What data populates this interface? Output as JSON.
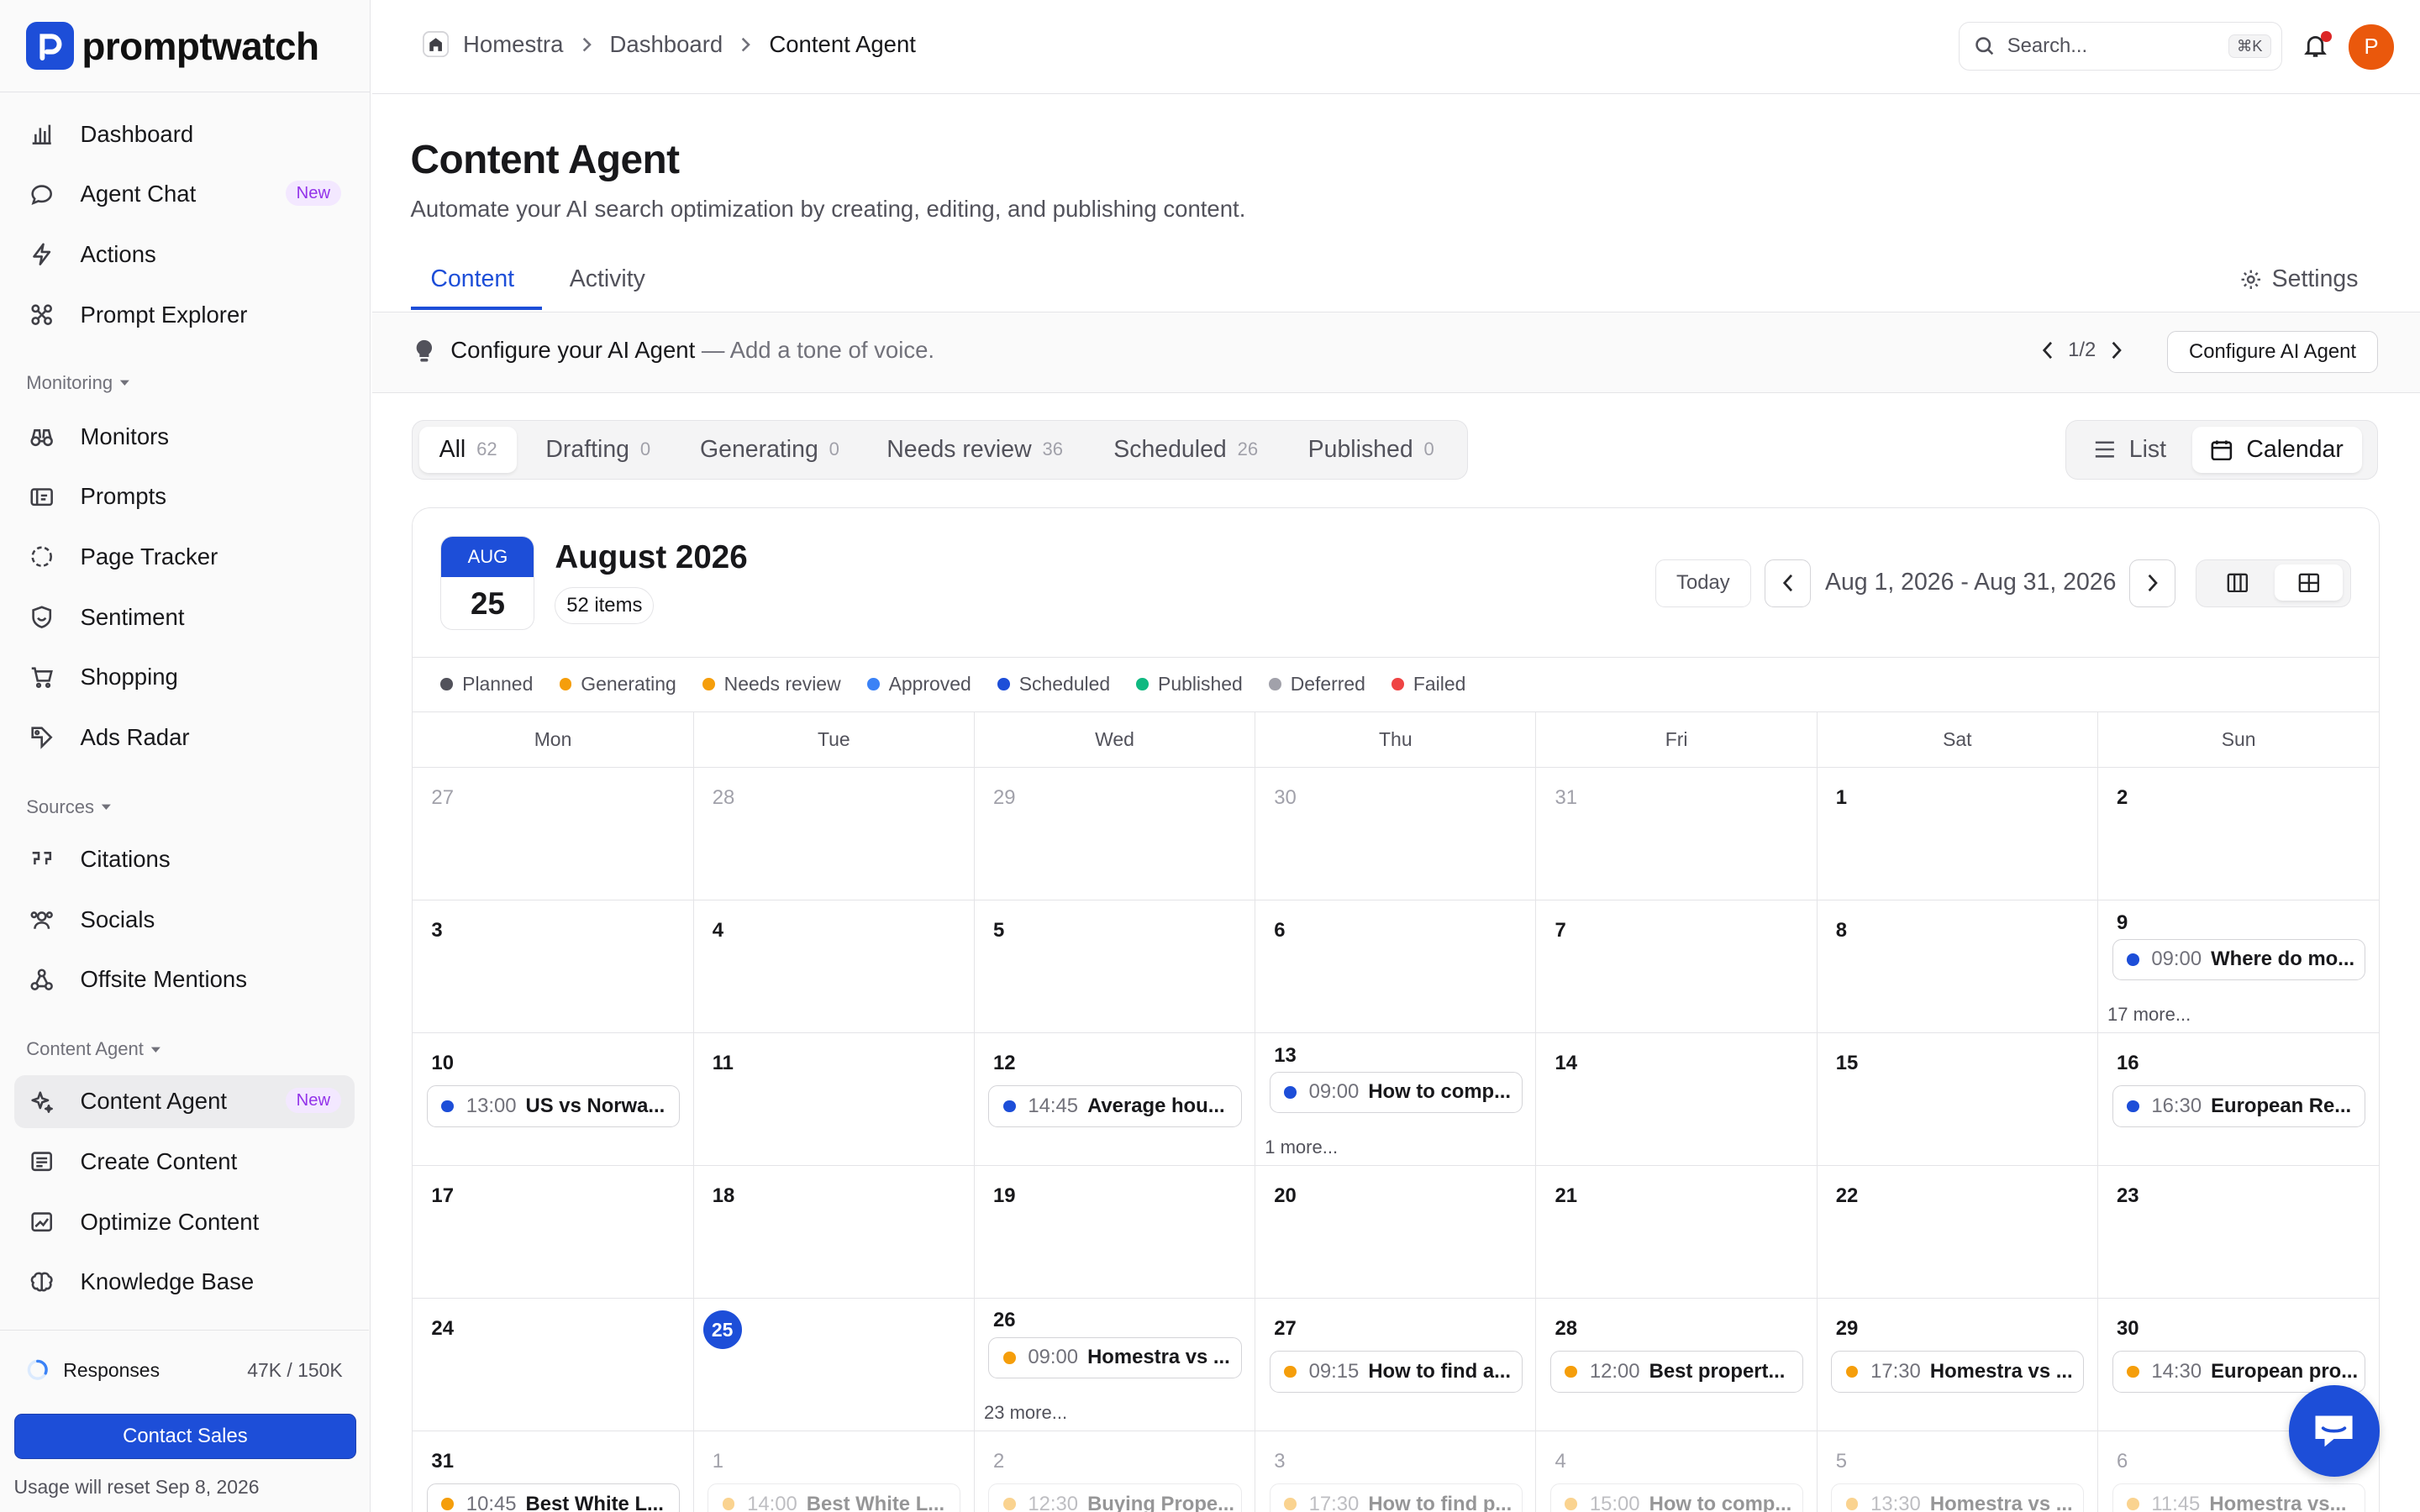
{
  "app": {
    "name": "promptwatch"
  },
  "sidebar": {
    "items": [
      {
        "label": "Dashboard"
      },
      {
        "label": "Agent Chat",
        "badge": "New"
      },
      {
        "label": "Actions"
      },
      {
        "label": "Prompt Explorer"
      }
    ],
    "monitoring": {
      "label": "Monitoring",
      "items": [
        {
          "label": "Monitors"
        },
        {
          "label": "Prompts"
        },
        {
          "label": "Page Tracker"
        },
        {
          "label": "Sentiment"
        },
        {
          "label": "Shopping"
        },
        {
          "label": "Ads Radar"
        }
      ]
    },
    "sources": {
      "label": "Sources",
      "items": [
        {
          "label": "Citations"
        },
        {
          "label": "Socials"
        },
        {
          "label": "Offsite Mentions"
        }
      ]
    },
    "content_agent": {
      "label": "Content Agent",
      "items": [
        {
          "label": "Content Agent",
          "badge": "New",
          "active": true
        },
        {
          "label": "Create Content"
        },
        {
          "label": "Optimize Content"
        },
        {
          "label": "Knowledge Base"
        }
      ]
    },
    "usage": {
      "label": "Responses",
      "value": "47K / 150K",
      "fraction": 0.313
    },
    "contact_button": "Contact Sales",
    "reset_note": "Usage will reset Sep 8, 2026"
  },
  "header": {
    "breadcrumb": [
      "Homestra",
      "Dashboard",
      "Content Agent"
    ],
    "search_placeholder": "Search...",
    "search_shortcut": "⌘K",
    "avatar_initial": "P"
  },
  "page": {
    "title": "Content Agent",
    "subtitle": "Automate your AI search optimization by creating, editing, and publishing content.",
    "tabs": [
      "Content",
      "Activity"
    ],
    "active_tab": "Content",
    "settings_label": "Settings"
  },
  "banner": {
    "title": "Configure your AI Agent",
    "detail": "— Add a tone of voice.",
    "pager": "1/2",
    "button": "Configure AI Agent"
  },
  "filters": [
    {
      "label": "All",
      "count": "62",
      "active": true
    },
    {
      "label": "Drafting",
      "count": "0"
    },
    {
      "label": "Generating",
      "count": "0"
    },
    {
      "label": "Needs review",
      "count": "36"
    },
    {
      "label": "Scheduled",
      "count": "26"
    },
    {
      "label": "Published",
      "count": "0"
    }
  ],
  "views": {
    "list": "List",
    "calendar": "Calendar",
    "active": "Calendar"
  },
  "calendar": {
    "chip_month": "AUG",
    "chip_day": "25",
    "title": "August 2026",
    "items_count": "52 items",
    "today_label": "Today",
    "range": "Aug 1, 2026 - Aug 31, 2026",
    "legend": [
      {
        "label": "Planned",
        "color": "#52525b"
      },
      {
        "label": "Generating",
        "color": "#f59e0b"
      },
      {
        "label": "Needs review",
        "color": "#f59e0b"
      },
      {
        "label": "Approved",
        "color": "#3b82f6"
      },
      {
        "label": "Scheduled",
        "color": "#1d4ed8"
      },
      {
        "label": "Published",
        "color": "#10b981"
      },
      {
        "label": "Deferred",
        "color": "#a1a1aa"
      },
      {
        "label": "Failed",
        "color": "#ef4444"
      }
    ],
    "weekdays": [
      "Mon",
      "Tue",
      "Wed",
      "Thu",
      "Fri",
      "Sat",
      "Sun"
    ],
    "weeks": [
      [
        {
          "d": "27",
          "muted": true
        },
        {
          "d": "28",
          "muted": true
        },
        {
          "d": "29",
          "muted": true
        },
        {
          "d": "30",
          "muted": true
        },
        {
          "d": "31",
          "muted": true
        },
        {
          "d": "1"
        },
        {
          "d": "2"
        }
      ],
      [
        {
          "d": "3"
        },
        {
          "d": "4"
        },
        {
          "d": "5"
        },
        {
          "d": "6"
        },
        {
          "d": "7"
        },
        {
          "d": "8"
        },
        {
          "d": "9",
          "event": {
            "time": "09:00",
            "title": "Where do mo...",
            "color": "#1d4ed8"
          },
          "more": "17 more..."
        }
      ],
      [
        {
          "d": "10",
          "event": {
            "time": "13:00",
            "title": "US vs Norwa...",
            "color": "#1d4ed8"
          }
        },
        {
          "d": "11"
        },
        {
          "d": "12",
          "event": {
            "time": "14:45",
            "title": "Average hou...",
            "color": "#1d4ed8"
          }
        },
        {
          "d": "13",
          "event": {
            "time": "09:00",
            "title": "How to comp...",
            "color": "#1d4ed8"
          },
          "more": "1 more..."
        },
        {
          "d": "14"
        },
        {
          "d": "15"
        },
        {
          "d": "16",
          "event": {
            "time": "16:30",
            "title": "European Re...",
            "color": "#1d4ed8"
          }
        }
      ],
      [
        {
          "d": "17"
        },
        {
          "d": "18"
        },
        {
          "d": "19"
        },
        {
          "d": "20"
        },
        {
          "d": "21"
        },
        {
          "d": "22"
        },
        {
          "d": "23"
        }
      ],
      [
        {
          "d": "24"
        },
        {
          "d": "25",
          "today": true
        },
        {
          "d": "26",
          "event": {
            "time": "09:00",
            "title": "Homestra vs ...",
            "color": "#f59e0b"
          },
          "more": "23 more..."
        },
        {
          "d": "27",
          "event": {
            "time": "09:15",
            "title": "How to find a...",
            "color": "#f59e0b"
          }
        },
        {
          "d": "28",
          "event": {
            "time": "12:00",
            "title": "Best propert...",
            "color": "#f59e0b"
          }
        },
        {
          "d": "29",
          "event": {
            "time": "17:30",
            "title": "Homestra vs ...",
            "color": "#f59e0b"
          }
        },
        {
          "d": "30",
          "event": {
            "time": "14:30",
            "title": "European pro...",
            "color": "#f59e0b"
          }
        }
      ],
      [
        {
          "d": "31",
          "event": {
            "time": "10:45",
            "title": "Best White L...",
            "color": "#f59e0b"
          }
        },
        {
          "d": "1",
          "muted": true,
          "event": {
            "time": "14:00",
            "title": "Best White L...",
            "color": "#f59e0b",
            "faded": true
          }
        },
        {
          "d": "2",
          "muted": true,
          "event": {
            "time": "12:30",
            "title": "Buying Prope...",
            "color": "#f59e0b",
            "faded": true
          }
        },
        {
          "d": "3",
          "muted": true,
          "event": {
            "time": "17:30",
            "title": "How to find p...",
            "color": "#f59e0b",
            "faded": true
          }
        },
        {
          "d": "4",
          "muted": true,
          "event": {
            "time": "15:00",
            "title": "How to comp...",
            "color": "#f59e0b",
            "faded": true
          }
        },
        {
          "d": "5",
          "muted": true,
          "event": {
            "time": "13:30",
            "title": "Homestra vs ...",
            "color": "#f59e0b",
            "faded": true
          }
        },
        {
          "d": "6",
          "muted": true,
          "event": {
            "time": "11:45",
            "title": "Homestra vs...",
            "color": "#f59e0b",
            "faded": true
          }
        }
      ]
    ]
  }
}
